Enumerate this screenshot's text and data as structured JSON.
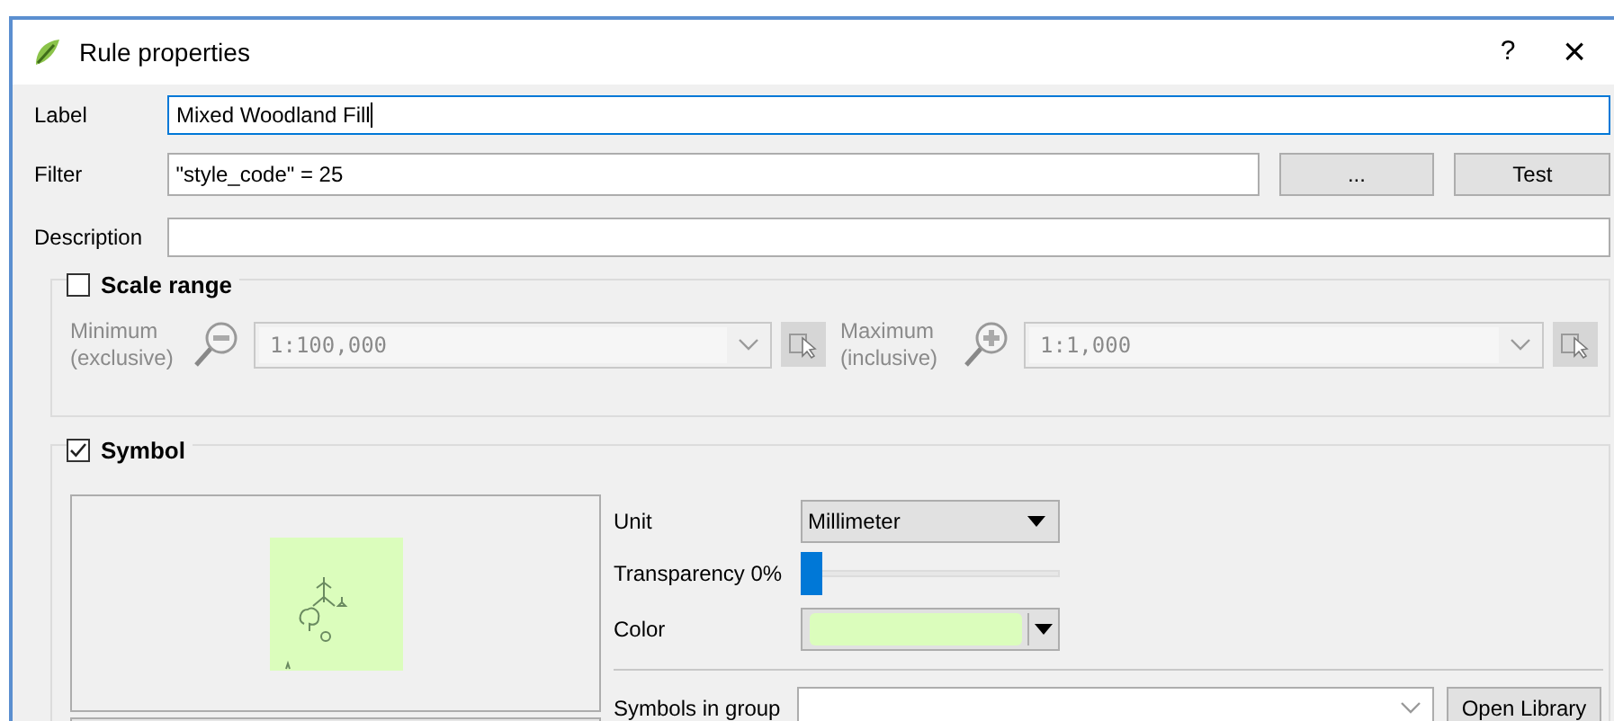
{
  "window": {
    "title": "Rule properties",
    "help": "?",
    "close": "×"
  },
  "label_field": {
    "label": "Label",
    "value": "Mixed Woodland Fill",
    "focused": true
  },
  "filter_field": {
    "label": "Filter",
    "value": "\"style_code\" = 25"
  },
  "filter_buttons": [
    "...",
    "Test"
  ],
  "description_field": {
    "label": "Description"
  },
  "scale_range": {
    "title": "Scale range",
    "checked": false,
    "disabled": true,
    "minimum": {
      "label_lines": [
        "Minimum",
        "(exclusive)"
      ],
      "value": "1:100,000"
    },
    "maximum": {
      "label_lines": [
        "Maximum",
        "(inclusive)"
      ],
      "value": "1:1,000"
    }
  },
  "symbol": {
    "title": "Symbol",
    "checked": true,
    "unit": {
      "label": "Unit",
      "value": "Millimeter"
    },
    "transparency": {
      "label": "Transparency 0%",
      "level": 0
    },
    "color": {
      "label": "Color",
      "color": "#dbfdbc"
    },
    "symbols_in_group": {
      "label": "Symbols in group"
    },
    "open_library": "Open Library"
  }
}
